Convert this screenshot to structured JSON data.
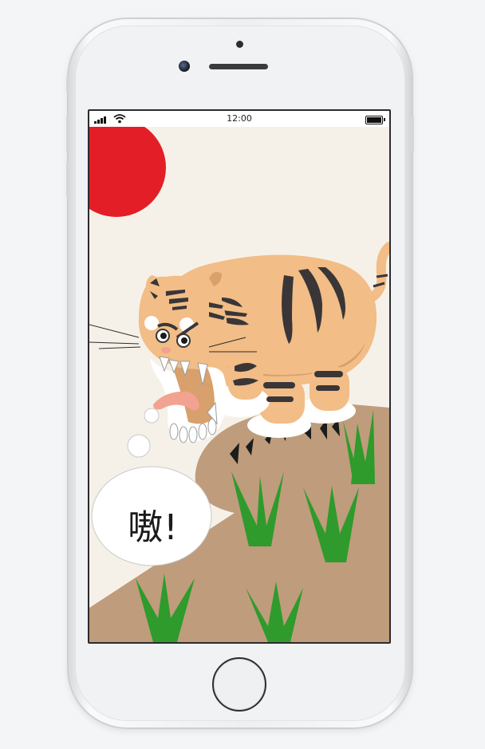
{
  "statusbar": {
    "time": "12:00",
    "signal_icon": "cellular-signal-icon",
    "wifi_icon": "wifi-icon",
    "battery_icon": "battery-icon"
  },
  "scene": {
    "speech_text": "嗷!",
    "colors": {
      "background": "#f6f1e8",
      "sun": "#e31e26",
      "hill": "#bf9c7c",
      "grass": "#2e9b2c",
      "tiger_body": "#f2bd86",
      "tiger_stripes": "#3a3638",
      "tongue": "#f2a290"
    }
  }
}
